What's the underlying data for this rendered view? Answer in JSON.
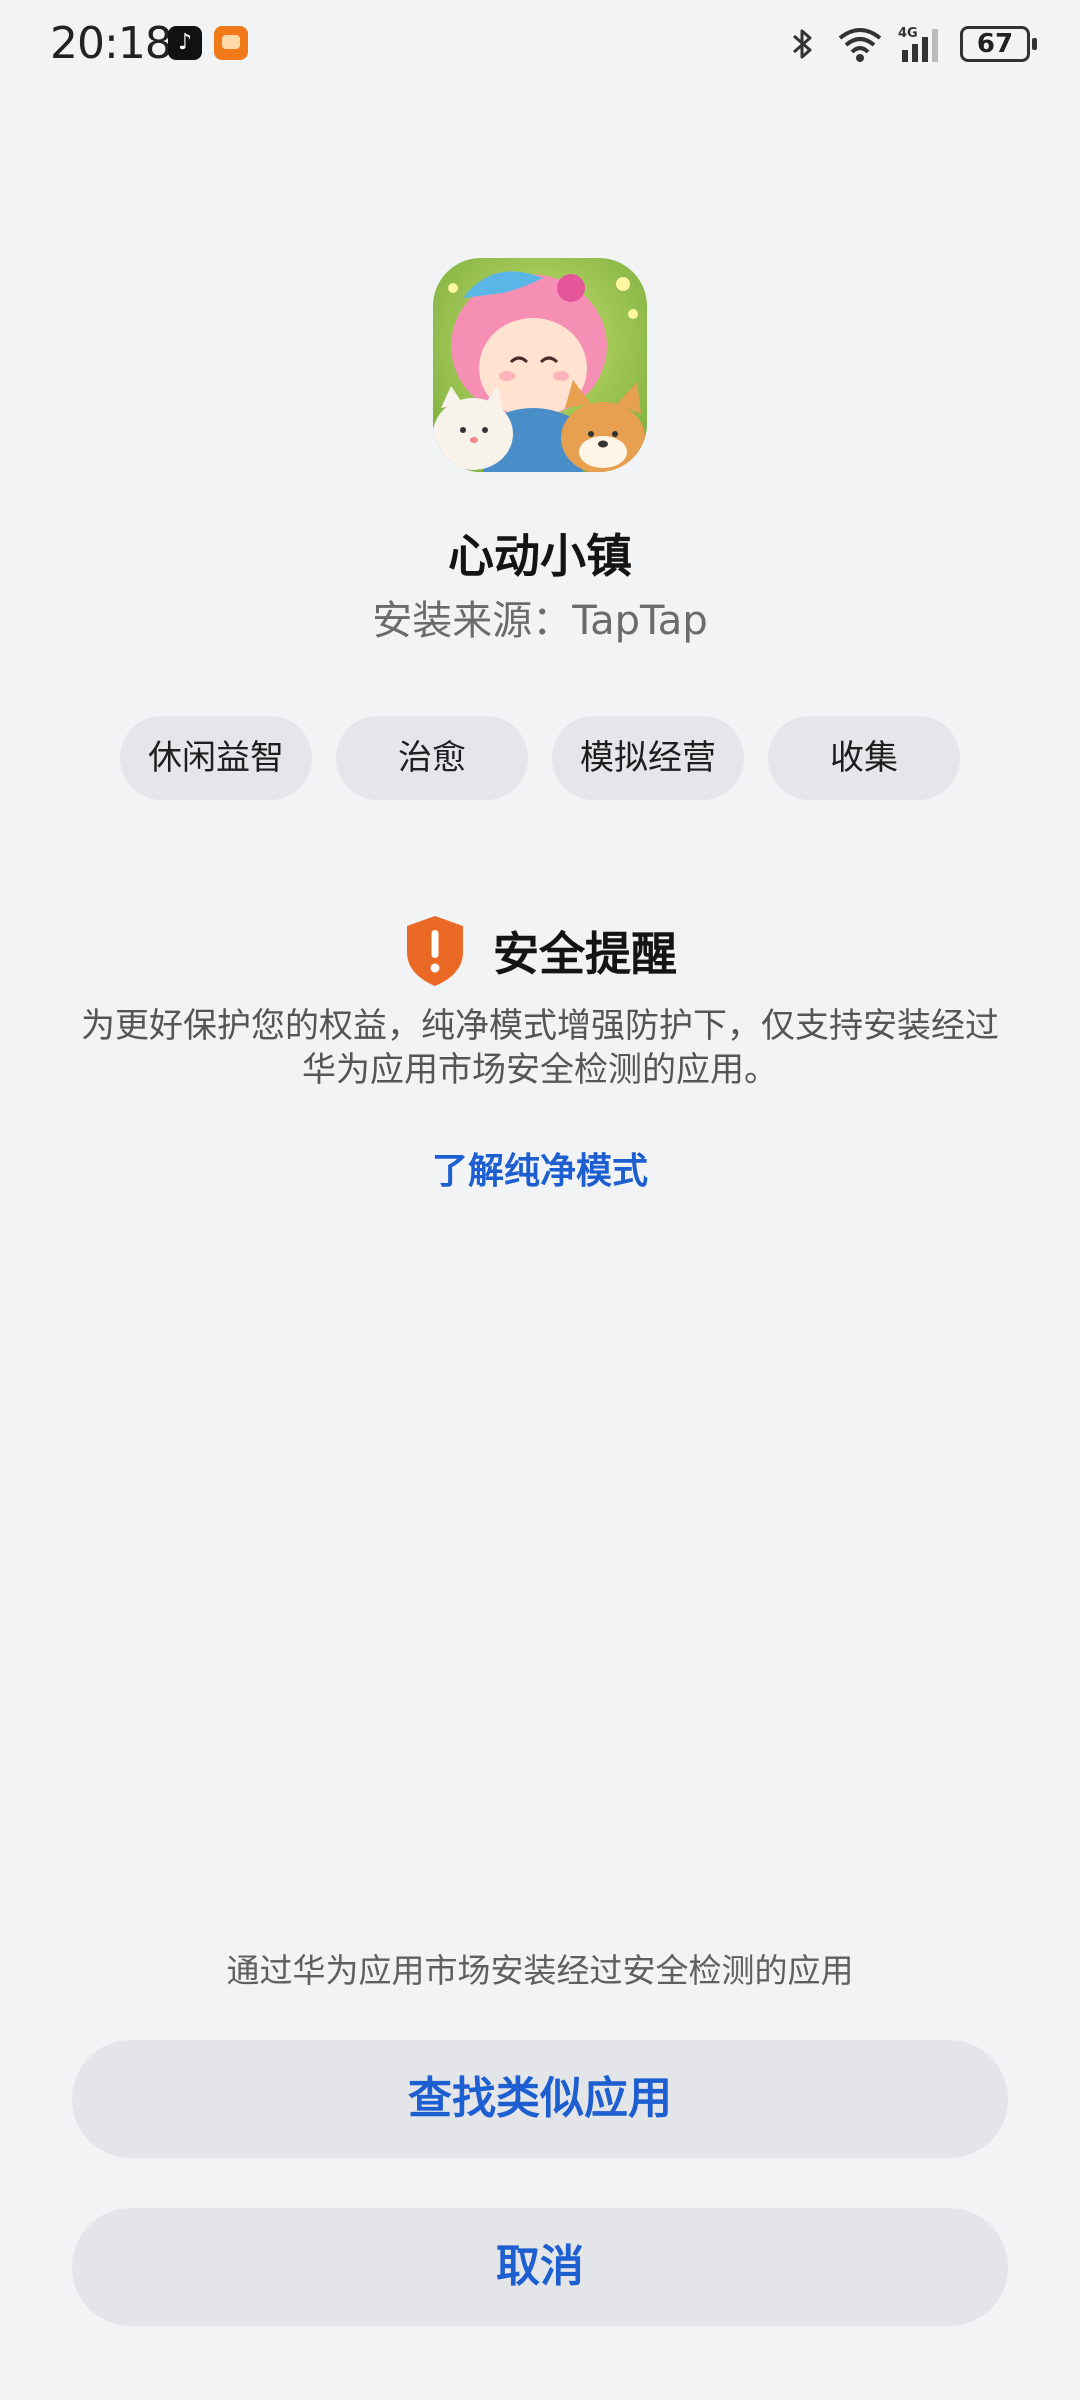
{
  "status_bar": {
    "time": "20:18",
    "network_label": "4G",
    "battery_level": "67",
    "icons": [
      "tiktok-icon",
      "app-notification-icon",
      "bluetooth-icon",
      "wifi-icon",
      "signal-icon",
      "battery-icon"
    ]
  },
  "app": {
    "name": "心动小镇",
    "source_label": "安装来源：",
    "source_value": "TapTap",
    "tags": [
      "休闲益智",
      "治愈",
      "模拟经营",
      "收集"
    ]
  },
  "security": {
    "title": "安全提醒",
    "description": "为更好保护您的权益，纯净模式增强防护下，仅支持安装经过华为应用市场安全检测的应用。",
    "learn_more_link": "了解纯净模式",
    "accent_color": "#ea6a25",
    "link_color": "#1d5fd1"
  },
  "bottom": {
    "hint": "通过华为应用市场安装经过安全检测的应用",
    "find_similar_button": "查找类似应用",
    "cancel_button": "取消"
  }
}
